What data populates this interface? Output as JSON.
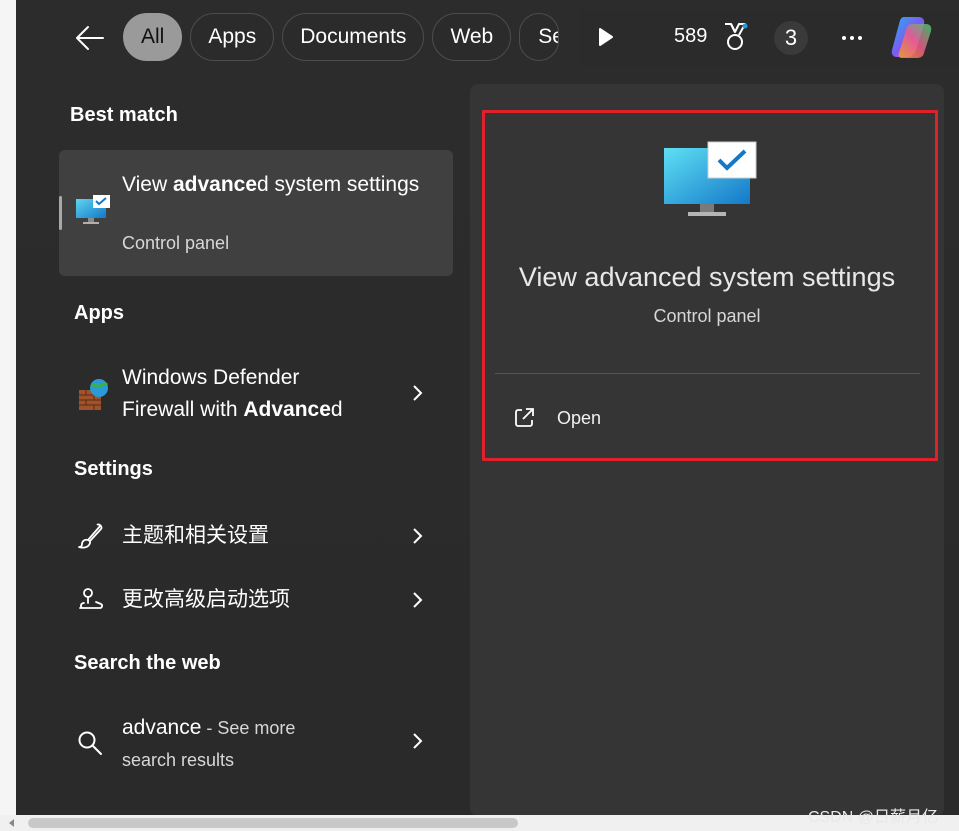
{
  "topbar": {
    "tabs": [
      {
        "label": "All",
        "active": true
      },
      {
        "label": "Apps"
      },
      {
        "label": "Documents"
      },
      {
        "label": "Web"
      },
      {
        "label": "Se"
      }
    ],
    "points": "589",
    "badge_count": "3"
  },
  "best_match": {
    "heading": "Best match",
    "title_pre": "View ",
    "title_bold": "advance",
    "title_post": "d system settings",
    "subtitle": "Control panel"
  },
  "apps": {
    "heading": "Apps",
    "items": [
      {
        "line1": "Windows Defender",
        "line2_pre": "Firewall with ",
        "line2_bold": "Advance",
        "line2_post": "d"
      }
    ]
  },
  "settings": {
    "heading": "Settings",
    "items": [
      {
        "label": "主题和相关设置",
        "icon": "brush-icon"
      },
      {
        "label": "更改高级启动选项",
        "icon": "startup-icon"
      }
    ]
  },
  "web": {
    "heading": "Search the web",
    "query": "advance",
    "suffix": " - See more",
    "line2": "search results"
  },
  "preview": {
    "title": "View advanced system settings",
    "subtitle": "Control panel",
    "open_label": "Open"
  },
  "watermark": "CSDN @日薪月亿",
  "colors": {
    "highlight": "#e0202a",
    "accent_blue": "#1f9bde"
  }
}
